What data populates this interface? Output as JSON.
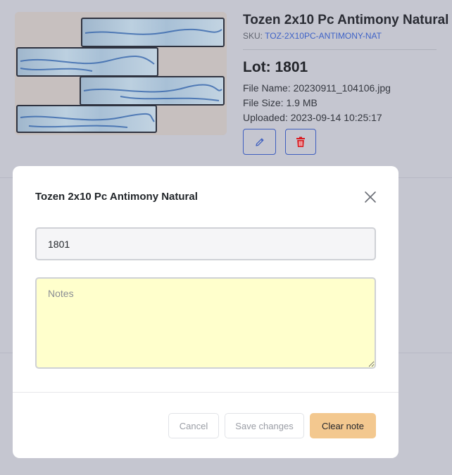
{
  "product": {
    "title": "Tozen 2x10 Pc Antimony Natural",
    "sku_label": "SKU:",
    "sku_value": "TOZ-2X10PC-ANTIMONY-NAT",
    "lot": "Lot: 1801",
    "file_name": "File Name: 20230911_104106.jpg",
    "file_size": "File Size: 1.9 MB",
    "uploaded": "Uploaded: 2023-09-14 10:25:17",
    "image_alt": "tile-photo"
  },
  "actions": {
    "edit_icon": "pencil-icon",
    "delete_icon": "trash-icon"
  },
  "modal": {
    "title": "Tozen 2x10 Pc Antimony Natural",
    "close_icon": "close-icon",
    "lot_value": "1801",
    "notes_placeholder": "Notes",
    "notes_value": "",
    "cancel_label": "Cancel",
    "save_label": "Save changes",
    "clear_label": "Clear note"
  },
  "colors": {
    "backdrop": "#c5c6d0",
    "accent": "#3f5fbf",
    "danger": "#d9161c",
    "notes_bg": "#ffffcc",
    "clear_button": "#f3c88f"
  }
}
